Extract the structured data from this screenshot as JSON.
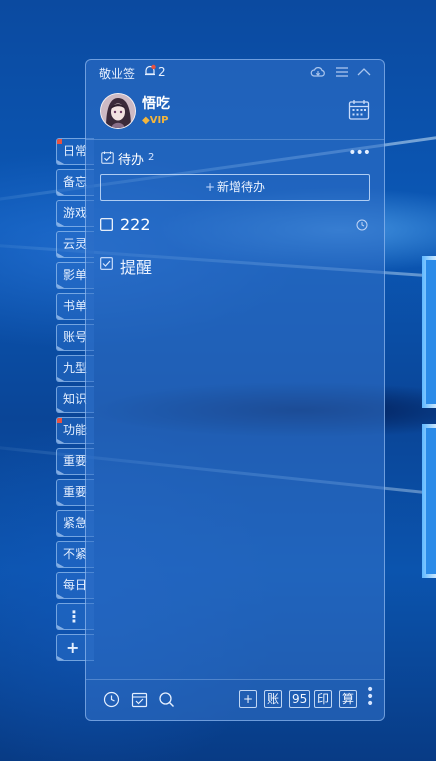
{
  "app": {
    "title": "敬业签",
    "notification_count": "2"
  },
  "user": {
    "name": "悟吃",
    "badge": "VIP"
  },
  "todo": {
    "title": "待办",
    "count": "2",
    "add_label": "新增待办"
  },
  "items": [
    {
      "text": "222",
      "checked": false
    },
    {
      "text": "提醒",
      "checked": true
    }
  ],
  "sidebar_tabs": [
    {
      "label": "日常",
      "flag": true
    },
    {
      "label": "备忘",
      "flag": false
    },
    {
      "label": "游戏",
      "flag": false
    },
    {
      "label": "云灵",
      "flag": false
    },
    {
      "label": "影单",
      "flag": false
    },
    {
      "label": "书单",
      "flag": false
    },
    {
      "label": "账号",
      "flag": false
    },
    {
      "label": "九型",
      "flag": false
    },
    {
      "label": "知识",
      "flag": false
    },
    {
      "label": "功能",
      "flag": true
    },
    {
      "label": "重要",
      "flag": false
    },
    {
      "label": "重要",
      "flag": false
    },
    {
      "label": "紧急",
      "flag": false
    },
    {
      "label": "不紧",
      "flag": false
    },
    {
      "label": "每日",
      "flag": false
    }
  ],
  "sidebar_buttons": {
    "more": "⋮",
    "add": "+"
  },
  "footer": {
    "add": "+",
    "account": "账",
    "number": "95",
    "print": "印",
    "calc": "算"
  },
  "colors": {
    "accent_red": "#e8523f",
    "vip_gold": "#f4b63c"
  }
}
